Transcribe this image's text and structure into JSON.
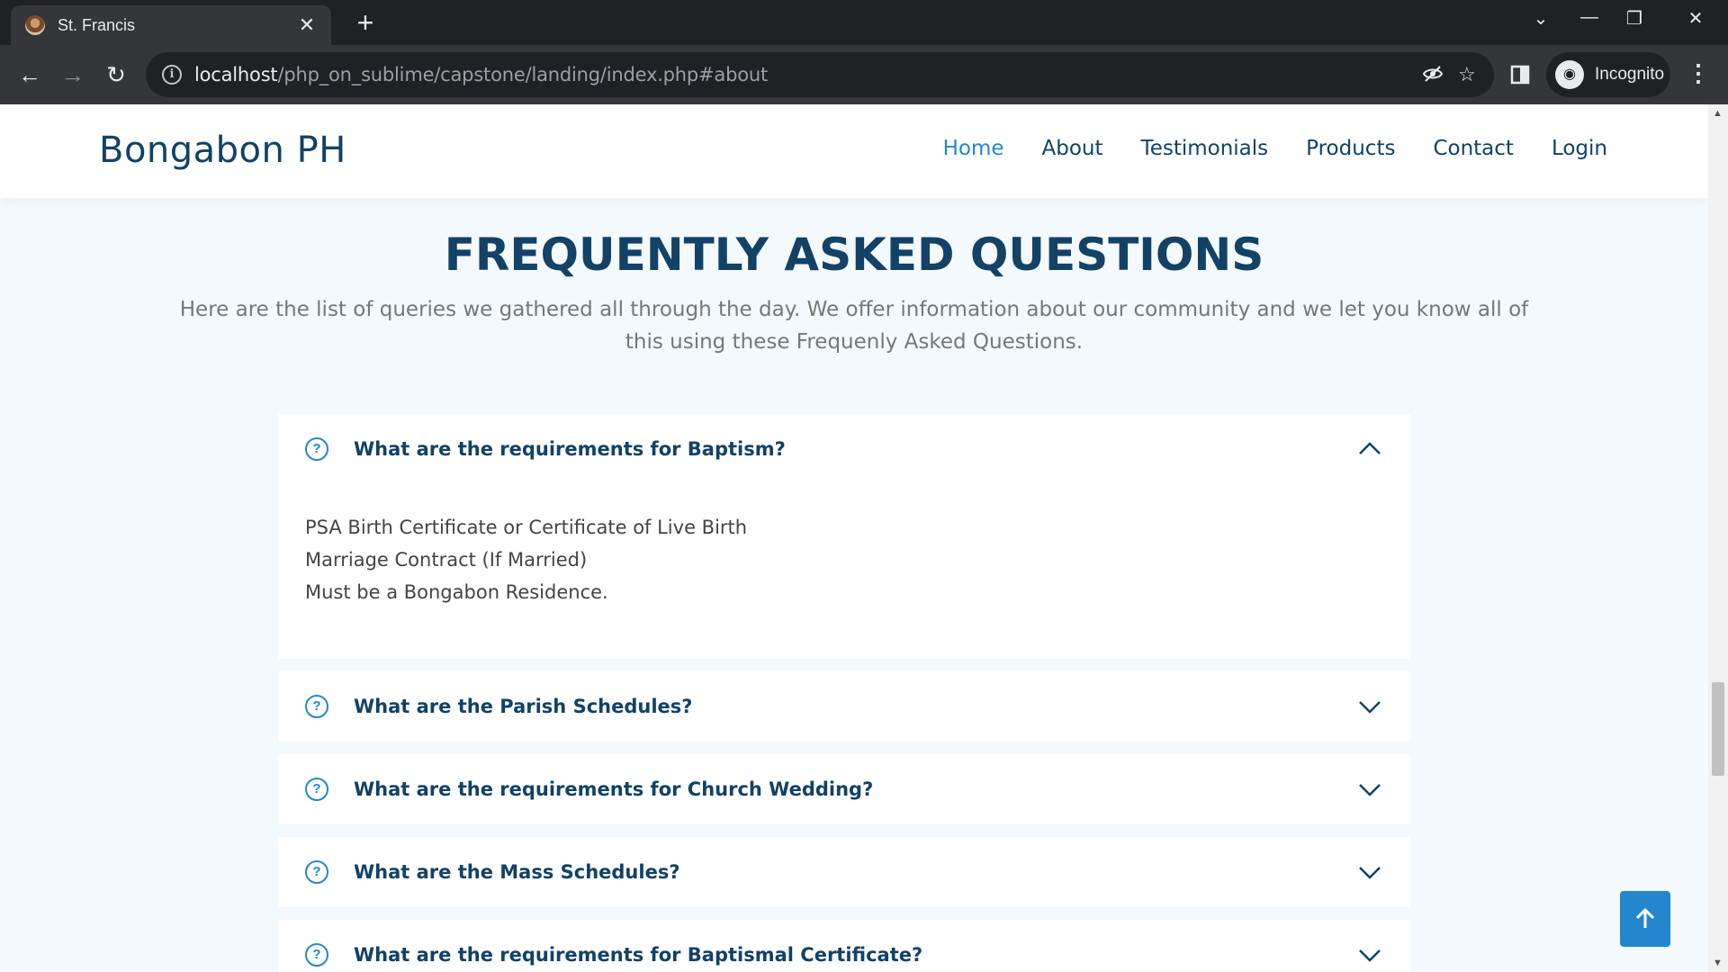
{
  "browser": {
    "tab_title": "St. Francis",
    "tab_close": "✕",
    "new_tab": "+",
    "url_host": "localhost",
    "url_path": "/php_on_sublime/capstone/landing/index.php#about",
    "profile_label": "Incognito"
  },
  "site": {
    "logo": "Bongabon PH",
    "nav": [
      "Home",
      "About",
      "Testimonials",
      "Products",
      "Contact",
      "Login"
    ],
    "active_nav": "Home"
  },
  "faq": {
    "title": "FREQUENTLY ASKED QUESTIONS",
    "description": "Here are the list of queries we gathered all through the day. We offer information about our community and we let you know all of this using these Frequenly Asked Questions.",
    "items": [
      {
        "question": "What are the requirements for Baptism?",
        "expanded": true,
        "answer_lines": [
          "PSA Birth Certificate or Certificate of Live Birth",
          "Marriage Contract (If Married)",
          "Must be a Bongabon Residence."
        ]
      },
      {
        "question": "What are the Parish Schedules?",
        "expanded": false
      },
      {
        "question": "What are the requirements for Church Wedding?",
        "expanded": false
      },
      {
        "question": "What are the Mass Schedules?",
        "expanded": false
      },
      {
        "question": "What are the requirements for Baptismal Certificate?",
        "expanded": false
      }
    ]
  },
  "colors": {
    "brand_dark": "#124265",
    "accent": "#2487ce",
    "section_bg": "#f4f9fd"
  }
}
